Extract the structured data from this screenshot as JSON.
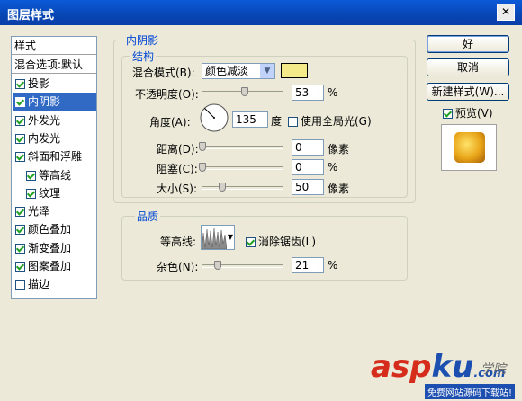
{
  "window": {
    "title": "图层样式",
    "close_label": "✕"
  },
  "styles_list": {
    "header": "样式",
    "blend_options": "混合选项:默认",
    "items": [
      {
        "label": "投影",
        "checked": true
      },
      {
        "label": "内阴影",
        "checked": true,
        "selected": true
      },
      {
        "label": "外发光",
        "checked": true
      },
      {
        "label": "内发光",
        "checked": true
      },
      {
        "label": "斜面和浮雕",
        "checked": true
      },
      {
        "label": "等高线",
        "checked": true,
        "indent": true
      },
      {
        "label": "纹理",
        "checked": true,
        "indent": true
      },
      {
        "label": "光泽",
        "checked": true
      },
      {
        "label": "颜色叠加",
        "checked": true
      },
      {
        "label": "渐变叠加",
        "checked": true
      },
      {
        "label": "图案叠加",
        "checked": true
      },
      {
        "label": "描边",
        "checked": false
      }
    ]
  },
  "panel": {
    "title": "内阴影",
    "structure": {
      "title": "结构",
      "blend_mode_label": "混合模式(B):",
      "blend_mode_value": "颜色减淡",
      "color_swatch": "#f5ea8a",
      "opacity_label": "不透明度(O):",
      "opacity_value": "53",
      "opacity_unit": "%",
      "opacity_fraction": 0.53,
      "angle_label": "角度(A):",
      "angle_value": "135",
      "angle_unit": "度",
      "global_light_label": "使用全局光(G)",
      "global_light_checked": false,
      "distance_label": "距离(D):",
      "distance_value": "0",
      "distance_unit": "像素",
      "choke_label": "阻塞(C):",
      "choke_value": "0",
      "choke_unit": "%",
      "size_label": "大小(S):",
      "size_value": "50",
      "size_unit": "像素"
    },
    "quality": {
      "title": "品质",
      "contour_label": "等高线:",
      "antialias_label": "消除锯齿(L)",
      "antialias_checked": true,
      "noise_label": "杂色(N):",
      "noise_value": "21",
      "noise_unit": "%"
    }
  },
  "buttons": {
    "ok": "好",
    "cancel": "取消",
    "new_style": "新建样式(W)...",
    "preview_label": "预览(V)",
    "preview_checked": true
  },
  "watermark": {
    "logo_asp": "asp",
    "logo_ku": "ku",
    "logo_tail": ".com",
    "tagline": "免费网站源码下载站!",
    "side_text": "学院"
  }
}
